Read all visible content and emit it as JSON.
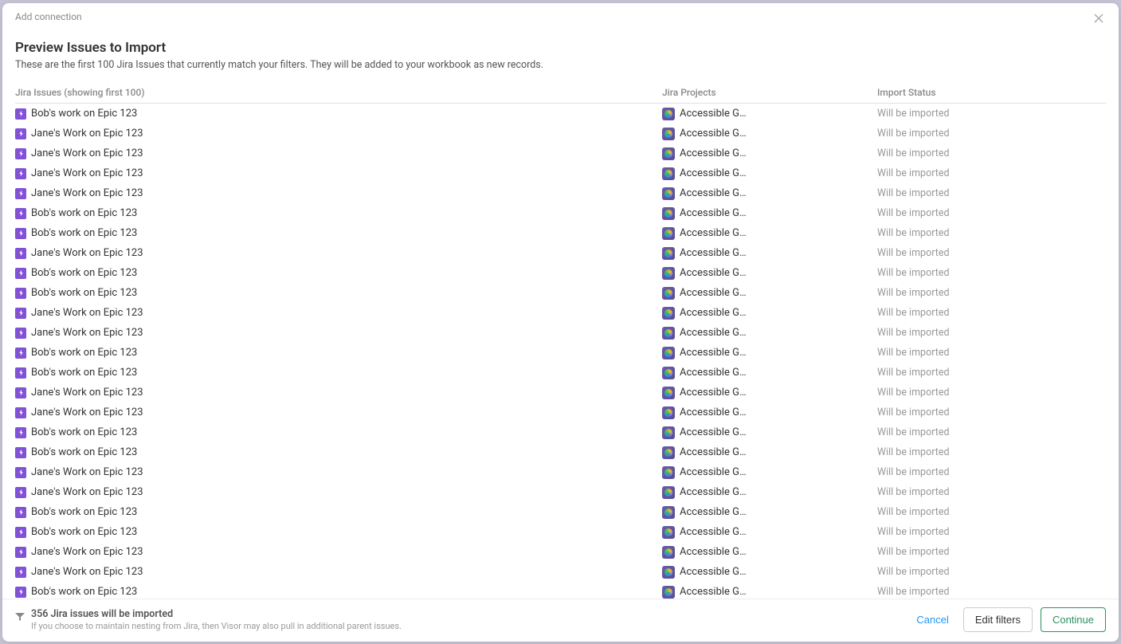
{
  "modal": {
    "breadcrumb": "Add connection",
    "close_label": "×"
  },
  "section": {
    "title": "Preview Issues to Import",
    "subtitle": "These are the first 100 Jira Issues that currently match your filters. They will be added to your workbook as new records."
  },
  "table": {
    "headers": {
      "issues": "Jira Issues (showing first 100)",
      "projects": "Jira Projects",
      "status": "Import Status"
    },
    "project_name": "Accessible Gami…",
    "status_text": "Will be imported",
    "rows": [
      {
        "issue": "Bob's work on Epic 123"
      },
      {
        "issue": "Jane's Work on Epic 123"
      },
      {
        "issue": "Jane's Work on Epic 123"
      },
      {
        "issue": "Jane's Work on Epic 123"
      },
      {
        "issue": "Jane's Work on Epic 123"
      },
      {
        "issue": "Bob's work on Epic 123"
      },
      {
        "issue": "Bob's work on Epic 123"
      },
      {
        "issue": "Jane's Work on Epic 123"
      },
      {
        "issue": "Bob's work on Epic 123"
      },
      {
        "issue": "Bob's work on Epic 123"
      },
      {
        "issue": "Jane's Work on Epic 123"
      },
      {
        "issue": "Jane's Work on Epic 123"
      },
      {
        "issue": "Bob's work on Epic 123"
      },
      {
        "issue": "Bob's work on Epic 123"
      },
      {
        "issue": "Jane's Work on Epic 123"
      },
      {
        "issue": "Jane's Work on Epic 123"
      },
      {
        "issue": "Bob's work on Epic 123"
      },
      {
        "issue": "Bob's work on Epic 123"
      },
      {
        "issue": "Jane's Work on Epic 123"
      },
      {
        "issue": "Jane's Work on Epic 123"
      },
      {
        "issue": "Bob's work on Epic 123"
      },
      {
        "issue": "Bob's work on Epic 123"
      },
      {
        "issue": "Jane's Work on Epic 123"
      },
      {
        "issue": "Jane's Work on Epic 123"
      },
      {
        "issue": "Bob's work on Epic 123"
      }
    ]
  },
  "footer": {
    "count_text": "356 Jira issues will be imported",
    "note_text": "If you choose to maintain nesting from Jira, then Visor may also pull in additional parent issues.",
    "cancel_label": "Cancel",
    "edit_filters_label": "Edit filters",
    "continue_label": "Continue"
  }
}
